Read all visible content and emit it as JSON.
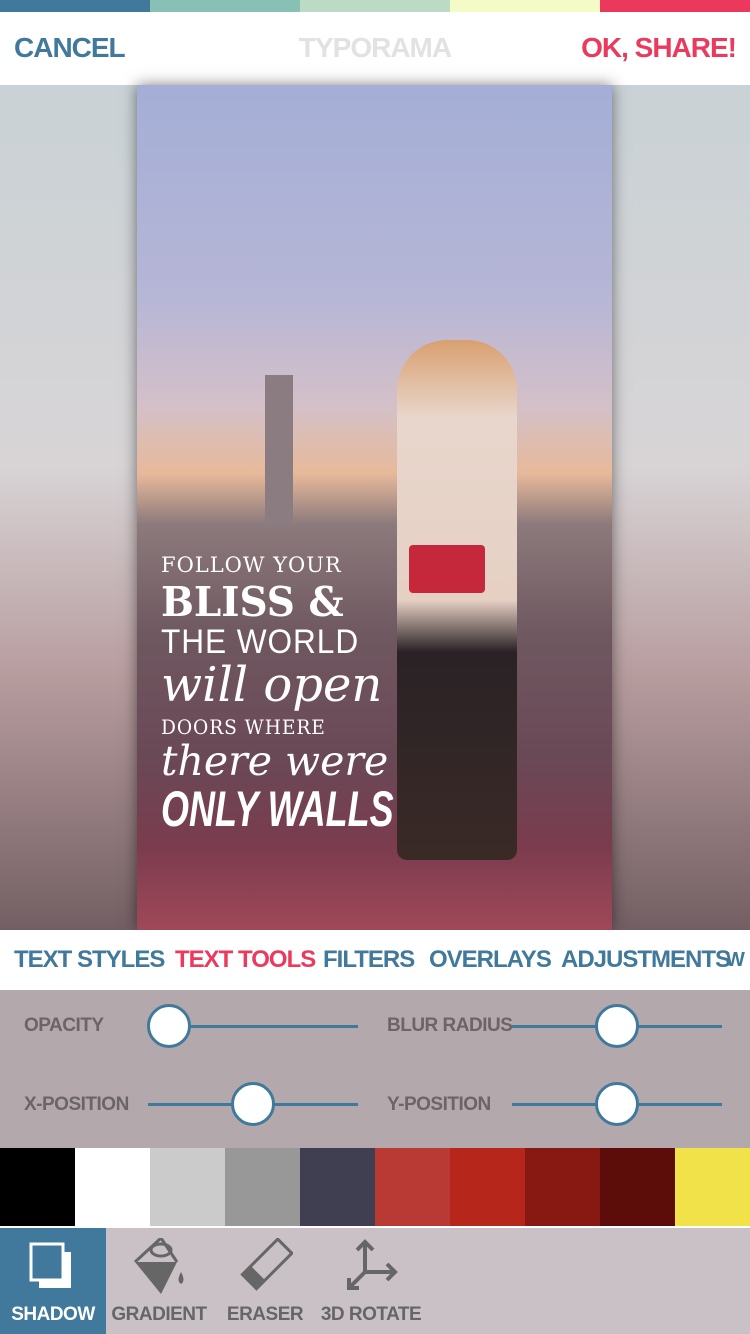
{
  "colors": {
    "bar": [
      "#41799c",
      "#88c0b5",
      "#bcdbc4",
      "#f4fbc4",
      "#ec385c"
    ],
    "accent": "#41799c",
    "highlight": "#ea3a5d"
  },
  "header": {
    "cancel": "CANCEL",
    "title": "TYPORAMA",
    "share": "OK, SHARE!"
  },
  "quote": [
    "FOLLOW YOUR",
    "BLISS &",
    "THE WORLD",
    "will open",
    "DOORS WHERE",
    "there were",
    "ONLY WALLS"
  ],
  "tabs": [
    {
      "label": "TEXT STYLES",
      "active": false
    },
    {
      "label": "TEXT TOOLS",
      "active": true
    },
    {
      "label": "FILTERS",
      "active": false
    },
    {
      "label": "OVERLAYS",
      "active": false
    },
    {
      "label": "ADJUSTMENTS",
      "active": false
    },
    {
      "label": "W",
      "active": false
    }
  ],
  "sliders": [
    {
      "label": "OPACITY",
      "value": 0.1
    },
    {
      "label": "BLUR RADIUS",
      "value": 0.5
    },
    {
      "label": "X-POSITION",
      "value": 0.5
    },
    {
      "label": "Y-POSITION",
      "value": 0.5
    }
  ],
  "swatches": [
    "#000000",
    "#ffffff",
    "#cbcbcb",
    "#989898",
    "#403f51",
    "#b93a34",
    "#b7261b",
    "#871812",
    "#5c0c09",
    "#f2e24a"
  ],
  "tools": [
    {
      "label": "SHADOW",
      "icon": "shadow-icon",
      "active": true
    },
    {
      "label": "GRADIENT",
      "icon": "paint-bucket-icon",
      "active": false
    },
    {
      "label": "ERASER",
      "icon": "eraser-icon",
      "active": false
    },
    {
      "label": "3D ROTATE",
      "icon": "axes-icon",
      "active": false
    }
  ]
}
